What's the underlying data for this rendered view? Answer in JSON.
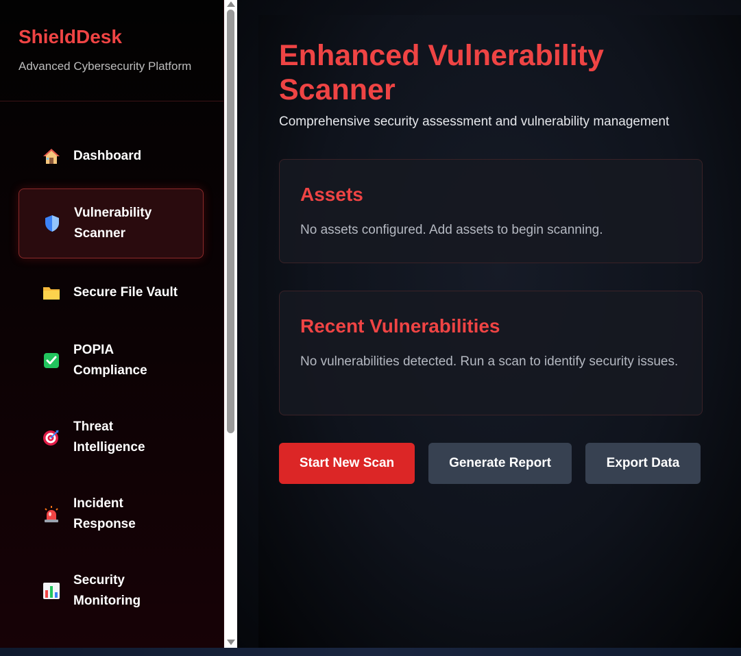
{
  "sidebar": {
    "brand_title": "ShieldDesk",
    "brand_subtitle": "Advanced Cybersecurity Platform",
    "items": [
      {
        "label": "Dashboard",
        "icon": "house-icon",
        "active": false
      },
      {
        "label": "Vulnerability Scanner",
        "icon": "shield-icon",
        "active": true
      },
      {
        "label": "Secure File Vault",
        "icon": "folder-icon",
        "active": false
      },
      {
        "label": "POPIA Compliance",
        "icon": "check-box-icon",
        "active": false
      },
      {
        "label": "Threat Intelligence",
        "icon": "target-icon",
        "active": false
      },
      {
        "label": "Incident Response",
        "icon": "siren-icon",
        "active": false
      },
      {
        "label": "Security Monitoring",
        "icon": "bar-chart-icon",
        "active": false
      }
    ]
  },
  "main": {
    "title": "Enhanced Vulnerability Scanner",
    "subtitle": "Comprehensive security assessment and vulnerability management",
    "assets_card": {
      "title": "Assets",
      "text": "No assets configured. Add assets to begin scanning."
    },
    "vulns_card": {
      "title": "Recent Vulnerabilities",
      "text": "No vulnerabilities detected. Run a scan to identify security issues."
    },
    "buttons": {
      "start_scan": "Start New Scan",
      "generate_report": "Generate Report",
      "export_data": "Export Data"
    }
  },
  "colors": {
    "accent": "#ef4444",
    "primary_button": "#dc2626",
    "secondary_button": "#374151"
  }
}
